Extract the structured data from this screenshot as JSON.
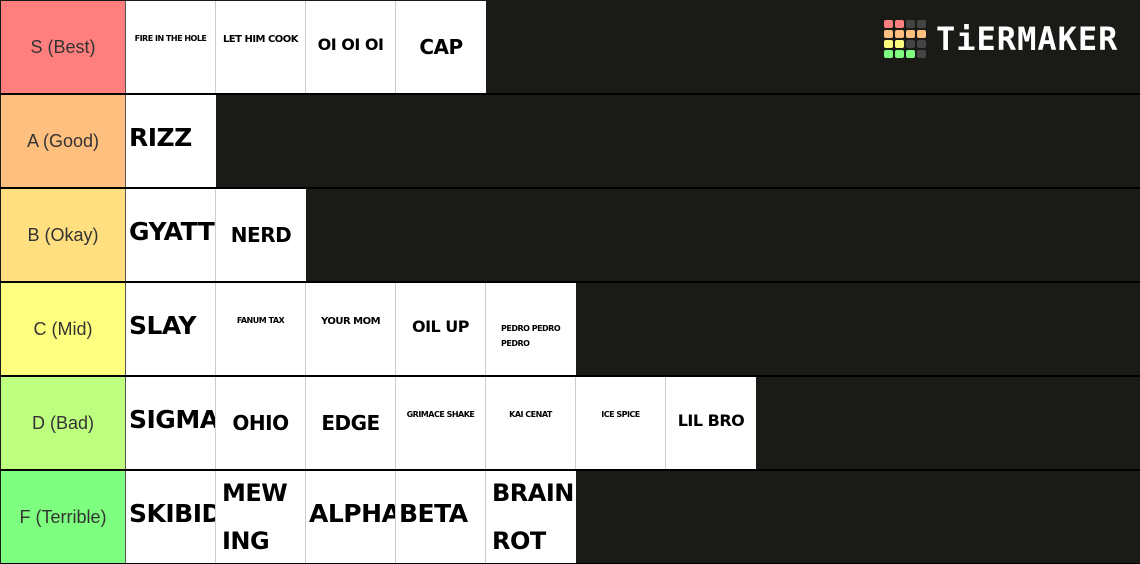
{
  "logo": {
    "text": "TiERMAKER",
    "grid_colors": [
      "#ff7f7f",
      "#ff7f7f",
      "#444444",
      "#444444",
      "#ffbf7f",
      "#ffbf7f",
      "#ffbf7f",
      "#ffbf7f",
      "#ffff7f",
      "#ffff7f",
      "#444444",
      "#444444",
      "#7fff7f",
      "#7fff7f",
      "#7fff7f",
      "#444444"
    ]
  },
  "tiers": [
    {
      "label": "S (Best)",
      "color": "#ff7f7f",
      "items": [
        {
          "text": "FIRE IN THE HOLE",
          "size": "xs"
        },
        {
          "text": "LET HIM COOK",
          "size": "sm"
        },
        {
          "text": "OI OI OI",
          "size": "md"
        },
        {
          "text": "CAP",
          "size": "lg"
        }
      ]
    },
    {
      "label": "A (Good)",
      "color": "#ffbf7f",
      "items": [
        {
          "text": "RIZZ",
          "size": "xl"
        }
      ]
    },
    {
      "label": "B (Okay)",
      "color": "#ffdf7f",
      "items": [
        {
          "text": "GYATT",
          "size": "xl"
        },
        {
          "text": "NERD",
          "size": "lg"
        }
      ]
    },
    {
      "label": "C (Mid)",
      "color": "#ffff7f",
      "items": [
        {
          "text": "SLAY",
          "size": "xl"
        },
        {
          "text": "FANUM TAX",
          "size": "xs"
        },
        {
          "text": "YOUR MOM",
          "size": "sm"
        },
        {
          "text": "OIL UP",
          "size": "md"
        },
        {
          "text": "PEDRO PEDRO PEDRO",
          "size": "xs"
        }
      ]
    },
    {
      "label": "D (Bad)",
      "color": "#bfff7f",
      "items": [
        {
          "text": "SIGMA",
          "size": "xl"
        },
        {
          "text": "OHIO",
          "size": "lg"
        },
        {
          "text": "EDGE",
          "size": "lg"
        },
        {
          "text": "GRIMACE SHAKE",
          "size": "xs"
        },
        {
          "text": "KAI CENAT",
          "size": "xs"
        },
        {
          "text": "ICE SPICE",
          "size": "xs"
        },
        {
          "text": "LIL BRO",
          "size": "md"
        }
      ]
    },
    {
      "label": "F (Terrible)",
      "color": "#7fff7f",
      "items": [
        {
          "text": "SKIBIDI",
          "size": "xl"
        },
        {
          "text": "MEW ING",
          "size": "tall"
        },
        {
          "text": "ALPHA",
          "size": "xl"
        },
        {
          "text": "BETA",
          "size": "xl"
        },
        {
          "text": "BRAIN ROT",
          "size": "tall"
        }
      ]
    }
  ]
}
